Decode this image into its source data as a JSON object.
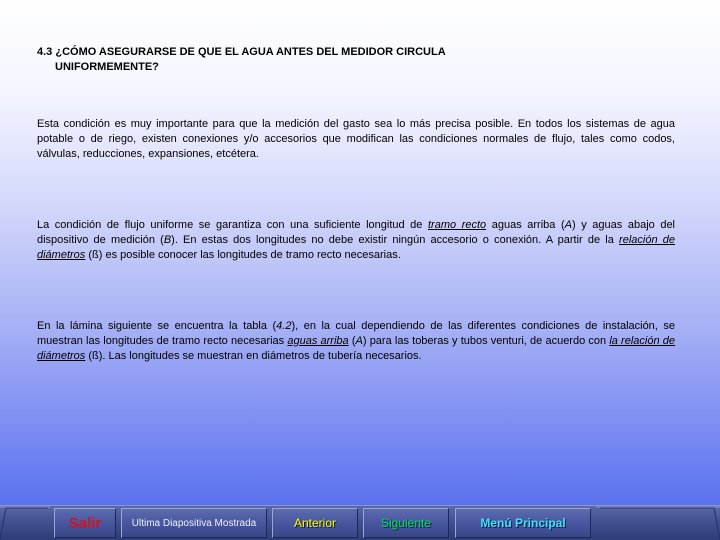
{
  "slide": {
    "title_line1": "4.3 ¿CÓMO ASEGURARSE DE QUE EL AGUA ANTES DEL MEDIDOR CIRCULA",
    "title_line2": "UNIFORMEMENTE?",
    "p1": "Esta condición es muy importante para que la medición del gasto sea lo más precisa posible. En todos los sistemas de agua potable o de riego, existen conexiones y/o accesorios que modifican las condiciones normales de flujo, tales como codos, válvulas, reducciones, expansiones, etcétera.",
    "p2": {
      "t1": "La condición de flujo uniforme se garantiza con una suficiente longitud de ",
      "link1": "tramo recto",
      "t2": " aguas arriba (",
      "a": "A",
      "t3": ") y aguas abajo del dispositivo de medición (",
      "b": "B",
      "t4": "). En estas dos longitudes no debe existir ningún accesorio o conexión. A partir de la ",
      "link2": "relación de diámetros",
      "t5": " (ß) es posible conocer las longitudes de tramo recto necesarias."
    },
    "p3": {
      "t1": "En la lámina siguiente se encuentra la tabla (",
      "tab": "4.2",
      "t2": "), en la cual dependiendo de las diferentes condiciones de instalación, se muestran las longitudes de tramo recto necesarias ",
      "link1": "aguas arriba",
      "t3": " (",
      "a": "A",
      "t4": ") para las toberas y tubos venturi, de acuerdo con ",
      "link2": "la relación de diámetros",
      "t5": " (ß). Las longitudes se muestran en diámetros de tubería necesarios."
    }
  },
  "nav": {
    "salir": "Salir",
    "ultima": "Ultima Diapositiva Mostrada",
    "anterior": "Anterior",
    "siguiente": "Siguiente",
    "menu": "Menú Principal"
  },
  "colors": {
    "salir": "#d2141e",
    "anterior": "#ffff00",
    "siguiente": "#00e05a",
    "menu": "#40e0ff"
  }
}
